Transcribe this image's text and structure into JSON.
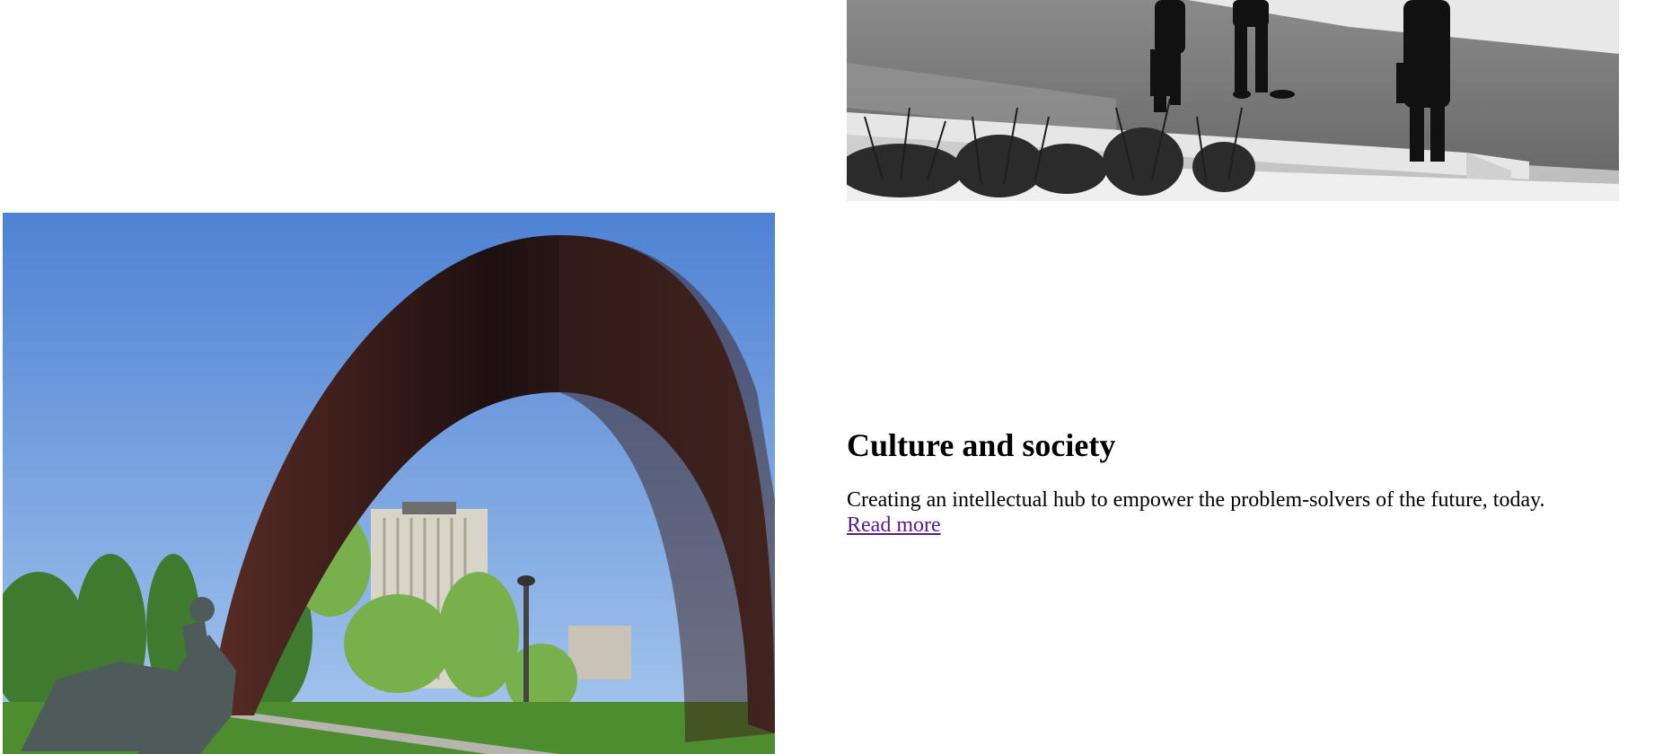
{
  "feature": {
    "title": "Culture and society",
    "description": "Creating an intellectual hub to empower the problem-solvers of the future, today.",
    "link_label": "Read more"
  },
  "colors": {
    "link_visited": "#551a8b",
    "text": "#000000",
    "background": "#ffffff"
  }
}
